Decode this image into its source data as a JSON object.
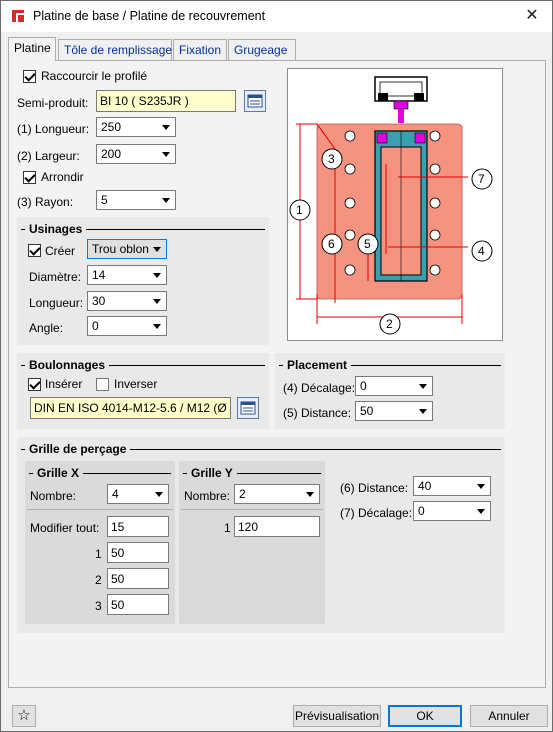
{
  "window": {
    "title": "Platine de base / Platine de recouvrement",
    "close_glyph": "✕"
  },
  "tabs": [
    "Platine",
    "Tôle de remplissage",
    "Fixation",
    "Grugeage"
  ],
  "platine": {
    "raccourcir_label": "Raccourcir le profilé",
    "semi_produit_label": "Semi-produit:",
    "semi_produit_value": "BI 10  ( S235JR )",
    "longueur_label": "(1) Longueur:",
    "longueur_value": "250",
    "largeur_label": "(2) Largeur:",
    "largeur_value": "200",
    "arrondir_label": "Arrondir",
    "rayon_label": "(3) Rayon:",
    "rayon_value": "5"
  },
  "usinages": {
    "title": "Usinages",
    "creer_label": "Créer",
    "type_value": "Trou oblon",
    "diametre_label": "Diamètre:",
    "diametre_value": "14",
    "longueur_label": "Longueur:",
    "longueur_value": "30",
    "angle_label": "Angle:",
    "angle_value": "0"
  },
  "boulonnages": {
    "title": "Boulonnages",
    "inserer_label": "Insérer",
    "inverser_label": "Inverser",
    "boulon_value": "DIN EN ISO 4014-M12-5.6 / M12 (Ø"
  },
  "placement": {
    "title": "Placement",
    "decalage_label": "(4) Décalage:",
    "decalage_value": "0",
    "distance_label": "(5) Distance:",
    "distance_value": "50"
  },
  "grille": {
    "title": "Grille de perçage",
    "x": {
      "title": "Grille X",
      "nombre_label": "Nombre:",
      "nombre_value": "4",
      "modifier_label": "Modifier tout:",
      "modifier_value": "15",
      "rows": [
        {
          "idx": "1",
          "value": "50"
        },
        {
          "idx": "2",
          "value": "50"
        },
        {
          "idx": "3",
          "value": "50"
        }
      ]
    },
    "y": {
      "title": "Grille Y",
      "nombre_label": "Nombre:",
      "nombre_value": "2",
      "rows": [
        {
          "idx": "1",
          "value": "120"
        }
      ]
    },
    "distance_label": "(6) Distance:",
    "distance_value": "40",
    "decalage_label": "(7) Décalage:",
    "decalage_value": "0"
  },
  "drawing": {
    "callouts": [
      "1",
      "2",
      "3",
      "4",
      "5",
      "6",
      "7"
    ],
    "colors": {
      "plate": "#f4937f",
      "dim": "#e00000",
      "profile_top": "#e000e0",
      "accent": "#1a6fd0"
    }
  },
  "footer": {
    "favorite_glyph": "☆",
    "preview_label": "Prévisualisation",
    "ok_label": "OK",
    "cancel_label": "Annuler"
  }
}
